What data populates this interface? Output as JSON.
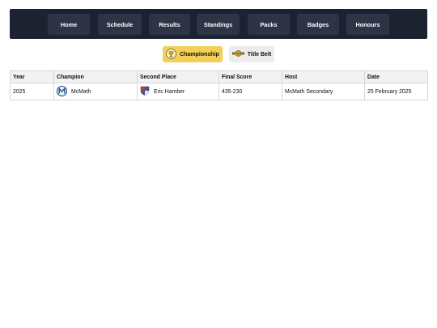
{
  "nav": {
    "items": [
      {
        "label": "Home"
      },
      {
        "label": "Schedule"
      },
      {
        "label": "Results"
      },
      {
        "label": "Standings"
      },
      {
        "label": "Packs"
      },
      {
        "label": "Badges"
      },
      {
        "label": "Honours"
      }
    ]
  },
  "toggles": {
    "championship": {
      "label": "Championship",
      "icon": "trophy-icon",
      "active": true
    },
    "title_belt": {
      "label": "Title Belt",
      "icon": "belt-icon",
      "active": false
    }
  },
  "colors": {
    "nav_bg": "#1c2230",
    "nav_button": "#2c3446",
    "accent": "#f3cf58",
    "header_bg": "#f2f2f2"
  },
  "table": {
    "headers": [
      "Year",
      "Champion",
      "Second Place",
      "Final Score",
      "Host",
      "Date"
    ],
    "rows": [
      {
        "year": "2025",
        "champion": "McMath",
        "champion_icon": "mcmath-logo-icon",
        "second_place": "Eric Hamber",
        "second_place_icon": "eric-hamber-logo-icon",
        "final_score": "435-230",
        "host": "McMath Secondary",
        "date": "25 February 2025"
      }
    ]
  }
}
